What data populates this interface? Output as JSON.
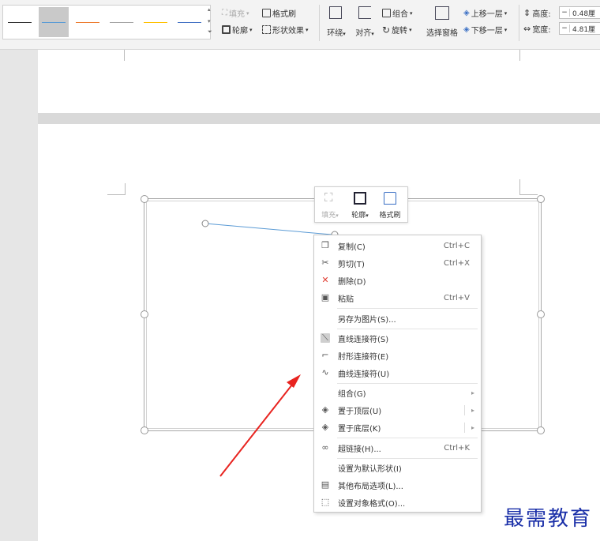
{
  "ribbon": {
    "line_styles": [
      {
        "color": "#333333"
      },
      {
        "color": "#5b9bd5",
        "selected": true
      },
      {
        "color": "#ed7d31"
      },
      {
        "color": "#a5a5a5"
      },
      {
        "color": "#ffc000"
      },
      {
        "color": "#4472c4"
      }
    ],
    "fill_label": "填充",
    "format_painter_label": "格式刷",
    "outline_label": "轮廓",
    "shape_effects_label": "形状效果",
    "wrap_label": "环绕",
    "align_label": "对齐",
    "group_label": "组合",
    "rotate_label": "旋转",
    "selection_pane_label": "选择窗格",
    "bring_forward_label": "上移一层",
    "send_backward_label": "下移一层",
    "height_label": "高度:",
    "height_value": "0.48厘",
    "width_label": "宽度:",
    "width_value": "4.81厘"
  },
  "mini_toolbar": {
    "fill_label": "填充",
    "outline_label": "轮廓",
    "format_painter_label": "格式刷"
  },
  "context_menu": {
    "copy": {
      "label": "复制(C)",
      "shortcut": "Ctrl+C"
    },
    "cut": {
      "label": "剪切(T)",
      "shortcut": "Ctrl+X"
    },
    "delete": {
      "label": "删除(D)"
    },
    "paste": {
      "label": "粘贴",
      "shortcut": "Ctrl+V"
    },
    "save_as_picture": {
      "label": "另存为图片(S)..."
    },
    "straight_connector": {
      "label": "直线连接符(S)"
    },
    "elbow_connector": {
      "label": "肘形连接符(E)"
    },
    "curved_connector": {
      "label": "曲线连接符(U)"
    },
    "group": {
      "label": "组合(G)"
    },
    "bring_to_front": {
      "label": "置于顶层(U)"
    },
    "send_to_back": {
      "label": "置于底层(K)"
    },
    "hyperlink": {
      "label": "超链接(H)...",
      "shortcut": "Ctrl+K"
    },
    "set_default_shape": {
      "label": "设置为默认形状(I)"
    },
    "more_layout": {
      "label": "其他布局选项(L)..."
    },
    "format_object": {
      "label": "设置对象格式(O)..."
    }
  },
  "colors": {
    "connector_line": "#5b9bd5",
    "arrow": "#e8231f",
    "watermark": "#1a2fa8"
  },
  "watermark_text": "最需教育"
}
